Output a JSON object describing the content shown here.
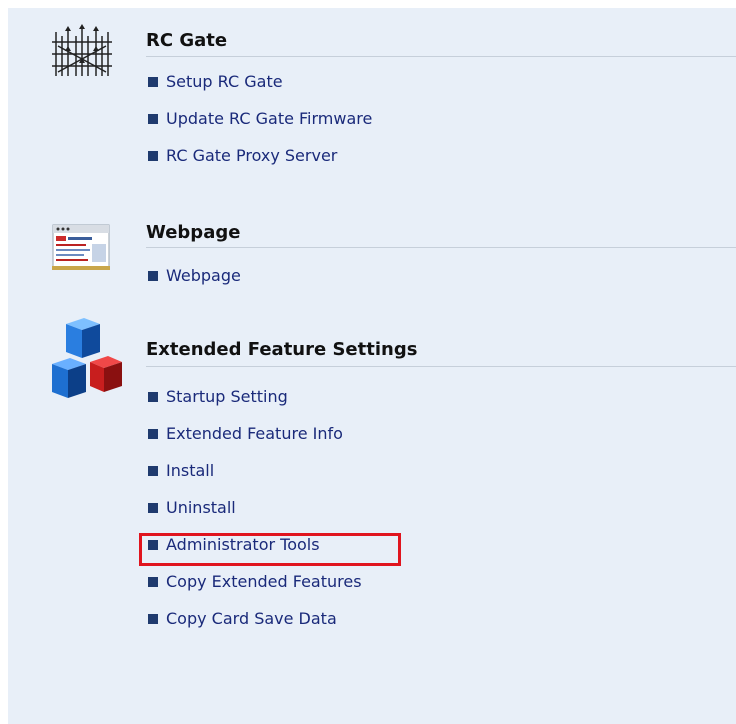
{
  "sections": [
    {
      "icon": "gate-fence-icon",
      "title": "RC Gate",
      "links": [
        "Setup RC Gate",
        "Update RC Gate Firmware",
        "RC Gate Proxy Server"
      ]
    },
    {
      "icon": "webpage-icon",
      "title": "Webpage",
      "links": [
        "Webpage"
      ]
    },
    {
      "icon": "cubes-icon",
      "title": "Extended Feature Settings",
      "links": [
        "Startup Setting",
        "Extended Feature Info",
        "Install",
        "Uninstall",
        "Administrator Tools",
        "Copy Extended Features",
        "Copy Card Save Data"
      ]
    }
  ],
  "highlight": {
    "target": "Administrator Tools",
    "color": "#e0141e"
  },
  "colors": {
    "panel_bg": "#e8eff8",
    "link": "#1a2a7a",
    "bullet": "#1f3a6e"
  }
}
